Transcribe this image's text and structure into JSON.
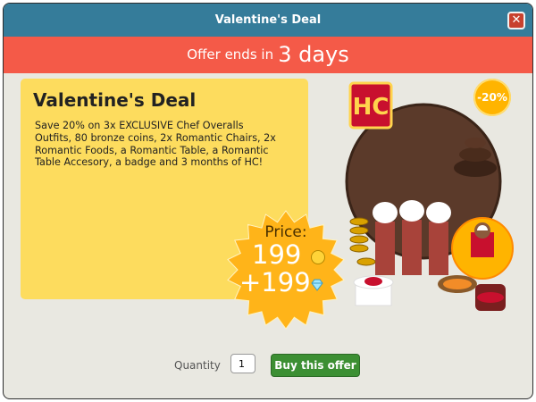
{
  "window": {
    "title": "Valentine's Deal"
  },
  "banner": {
    "prefix": "Offer ends in",
    "value": "3 days"
  },
  "offer": {
    "title": "Valentine's Deal",
    "description": "Save 20% on 3x EXCLUSIVE Chef Overalls Outfits, 80 bronze coins, 2x Romantic Chairs, 2x Romantic Foods, a Romantic Table, a Romantic Table Accesory, a badge and 3 months of HC!",
    "price_label": "Price:",
    "price_credits": "199",
    "price_diamonds": "+199",
    "discount": "-20%"
  },
  "purchase": {
    "quantity_label": "Quantity",
    "quantity_value": "1",
    "buy_label": "Buy this offer"
  },
  "colors": {
    "titlebar": "#357c9a",
    "banner": "#f45a48",
    "panel": "#fddc5e",
    "buy": "#3c8f33",
    "burst": "#ffb419"
  },
  "icons": [
    "close-icon",
    "credit-coin-icon",
    "diamond-icon"
  ]
}
